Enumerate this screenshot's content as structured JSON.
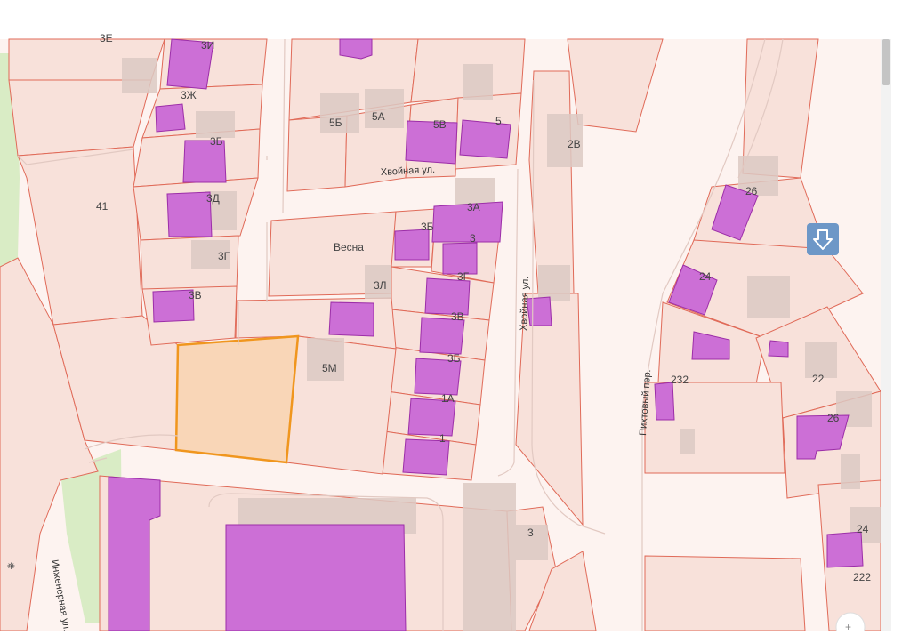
{
  "map": {
    "parcel_labels": [
      "3Е",
      "3И",
      "3Ж",
      "3Б",
      "3Д",
      "3Г",
      "3В",
      "41",
      "Весна",
      "3Л",
      "5М",
      "5Б",
      "5А",
      "5В",
      "5",
      "3А",
      "3",
      "3Б",
      "3Г",
      "3В",
      "3Б",
      "1А",
      "1",
      "2В",
      "26",
      "24",
      "232",
      "22",
      "26",
      "24",
      "222",
      "3"
    ],
    "streets": {
      "khvoynaya_horizontal": "Хвойная ул.",
      "khvoynaya_vertical": "Хвойная ул.",
      "pikhtovy": "Пихтовый пер.",
      "inzhenernaya": "Инженерная ул."
    },
    "icons": {
      "locate_pin": "arrow-down-icon",
      "zoom": "plus-icon"
    },
    "colors": {
      "parcel_fill": "#f8e1da",
      "parcel_border": "#e06a58",
      "building": "#cc6fd6",
      "selected_fill": "#f9d6b7",
      "selected_border": "#f0961e",
      "green_area": "#d9ecc5"
    }
  }
}
